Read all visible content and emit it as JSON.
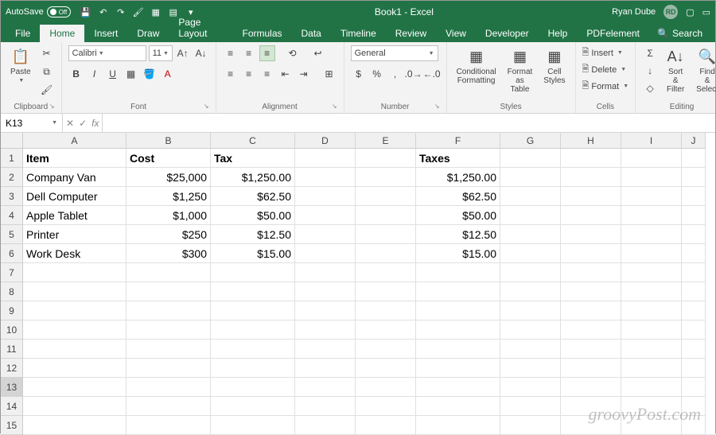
{
  "titlebar": {
    "autosave_label": "AutoSave",
    "autosave_state": "Off",
    "doc_title": "Book1 - Excel",
    "user_name": "Ryan Dube",
    "user_initials": "RD"
  },
  "tabs": {
    "file": "File",
    "home": "Home",
    "insert": "Insert",
    "draw": "Draw",
    "page_layout": "Page Layout",
    "formulas": "Formulas",
    "data": "Data",
    "timeline": "Timeline",
    "review": "Review",
    "view": "View",
    "developer": "Developer",
    "help": "Help",
    "pdfelement": "PDFelement",
    "search": "Search"
  },
  "ribbon": {
    "clipboard": {
      "paste": "Paste",
      "label": "Clipboard"
    },
    "font": {
      "name": "Calibri",
      "size": "11",
      "bold": "B",
      "italic": "I",
      "underline": "U",
      "label": "Font"
    },
    "alignment": {
      "label": "Alignment"
    },
    "number": {
      "format": "General",
      "label": "Number"
    },
    "styles": {
      "conditional": "Conditional Formatting",
      "table": "Format as Table",
      "cell": "Cell Styles",
      "label": "Styles"
    },
    "cells": {
      "insert": "Insert",
      "delete": "Delete",
      "format": "Format",
      "label": "Cells"
    },
    "editing": {
      "sort": "Sort & Filter",
      "find": "Find & Select",
      "label": "Editing"
    }
  },
  "formula_bar": {
    "name_box": "K13",
    "fx": "fx"
  },
  "columns": [
    "A",
    "B",
    "C",
    "D",
    "E",
    "F",
    "G",
    "H",
    "I",
    "J"
  ],
  "rows": [
    "1",
    "2",
    "3",
    "4",
    "5",
    "6",
    "7",
    "8",
    "9",
    "10",
    "11",
    "12",
    "13",
    "14",
    "15"
  ],
  "headers": {
    "item": "Item",
    "cost": "Cost",
    "tax": "Tax",
    "taxes": "Taxes"
  },
  "data_rows": [
    {
      "item": "Company Van",
      "cost": "$25,000",
      "tax": "$1,250.00",
      "taxes": "$1,250.00"
    },
    {
      "item": "Dell Computer",
      "cost": "$1,250",
      "tax": "$62.50",
      "taxes": "$62.50"
    },
    {
      "item": "Apple Tablet",
      "cost": "$1,000",
      "tax": "$50.00",
      "taxes": "$50.00"
    },
    {
      "item": "Printer",
      "cost": "$250",
      "tax": "$12.50",
      "taxes": "$12.50"
    },
    {
      "item": "Work Desk",
      "cost": "$300",
      "tax": "$15.00",
      "taxes": "$15.00"
    }
  ],
  "watermark": "groovyPost.com"
}
